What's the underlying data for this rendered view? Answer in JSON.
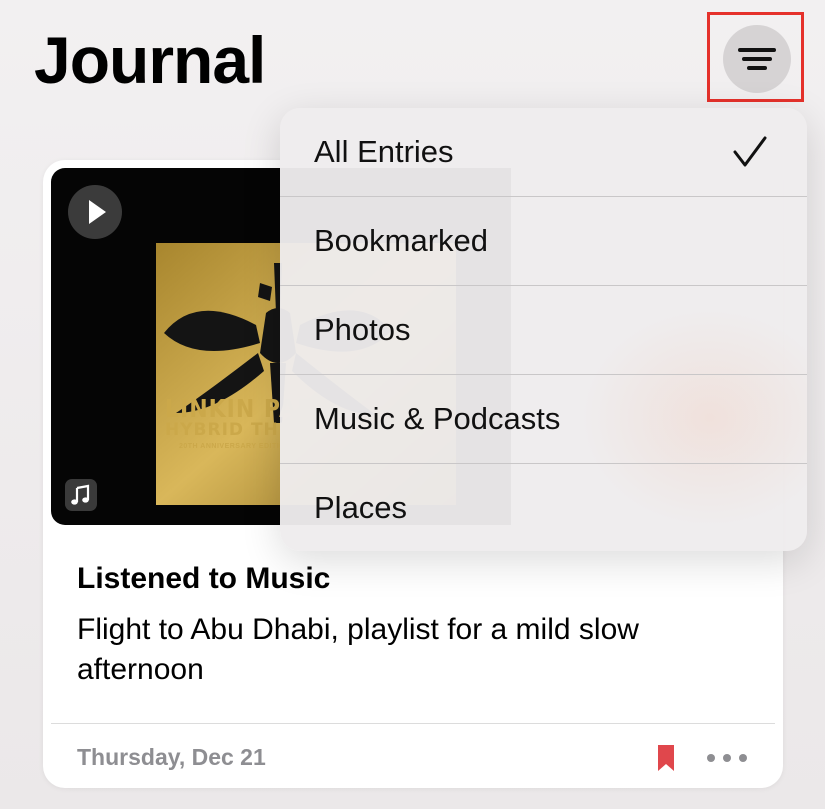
{
  "header": {
    "title": "Journal"
  },
  "filter_button": {
    "icon": "filter-lines-icon",
    "highlight_color": "#e5312b"
  },
  "filter_menu": {
    "items": [
      {
        "label": "All Entries",
        "selected": true
      },
      {
        "label": "Bookmarked",
        "selected": false
      },
      {
        "label": "Photos",
        "selected": false
      },
      {
        "label": "Music & Podcasts",
        "selected": false
      },
      {
        "label": "Places",
        "selected": false
      }
    ],
    "check_icon": "checkmark-icon"
  },
  "entry": {
    "artwork": {
      "album_title": "LINKIN PAR",
      "album_subtitle": "HYBRID THEOR",
      "album_edition": "20TH ANNIVERSARY EDITION",
      "play_icon": "play-icon",
      "badge_icon": "music-note-icon"
    },
    "title": "Listened to Music",
    "body": "Flight to Abu Dhabi, playlist for a mild slow afternoon",
    "date": "Thursday, Dec 21",
    "bookmark_icon": "bookmark-icon",
    "bookmark_color": "#e0474c",
    "more_icon": "more-dots-icon"
  }
}
